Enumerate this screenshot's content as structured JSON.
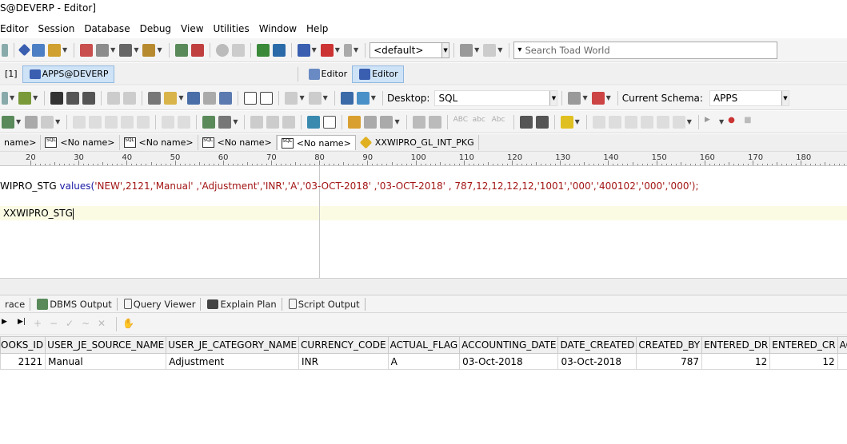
{
  "window": {
    "title": "S@DEVERP - Editor]"
  },
  "menu": [
    "Editor",
    "Session",
    "Database",
    "Debug",
    "View",
    "Utilities",
    "Window",
    "Help"
  ],
  "toolbar1": {
    "schema_combo": "<default>",
    "search_placeholder": "Search Toad World"
  },
  "connections": {
    "index_label": "[1]",
    "connection_name": "APPS@DEVERP",
    "editor_tab_1": "Editor",
    "editor_tab_2": "Editor"
  },
  "toolbar2": {
    "desktop_label": "Desktop:",
    "desktop_value": "SQL",
    "schema_label": "Current Schema:",
    "schema_value": "APPS"
  },
  "doc_tabs": [
    {
      "label": "name>",
      "icon": "none",
      "active": false
    },
    {
      "label": "<No name>",
      "icon": "sql-file-icon",
      "active": false
    },
    {
      "label": "<No name>",
      "icon": "sql-file-icon",
      "active": false
    },
    {
      "label": "<No name>",
      "icon": "sql-file-icon",
      "active": false
    },
    {
      "label": "<No name>",
      "icon": "sql-file-icon",
      "active": true
    },
    {
      "label": "XXWIPRO_GL_INT_PKG",
      "icon": "package-icon",
      "active": false
    }
  ],
  "ruler": [
    "20",
    "30",
    "40",
    "50",
    "60",
    "70",
    "80",
    "90",
    "100",
    "110",
    "120",
    "130",
    "140",
    "150",
    "160",
    "170",
    "180"
  ],
  "editor": {
    "line1_prefix": "WIPRO_STG ",
    "line1_kw": "values(",
    "line1_args": "'NEW',2121,'Manual' ,'Adjustment','INR','A','03-OCT-2018' ,'03-OCT-2018' , 787,12,12,12,12,'1001','000','400102','000','000');",
    "line2": " XXWIPRO_STG"
  },
  "output_tabs": [
    "race",
    "DBMS Output",
    "Query Viewer",
    "Explain Plan",
    "Script Output"
  ],
  "grid": {
    "columns": [
      "OOKS_ID",
      "USER_JE_SOURCE_NAME",
      "USER_JE_CATEGORY_NAME",
      "CURRENCY_CODE",
      "ACTUAL_FLAG",
      "ACCOUNTING_DATE",
      "DATE_CREATED",
      "CREATED_BY",
      "ENTERED_DR",
      "ENTERED_CR",
      "ACCO"
    ],
    "rows": [
      [
        "2121",
        "Manual",
        "Adjustment",
        "INR",
        "A",
        "03-Oct-2018",
        "03-Oct-2018",
        "787",
        "12",
        "12",
        ""
      ]
    ]
  },
  "colors": {
    "blue": "#1a1aa6",
    "string": "#a31515",
    "current_line": "#fbfbe4",
    "selected_tab": "#cfe3f7"
  }
}
